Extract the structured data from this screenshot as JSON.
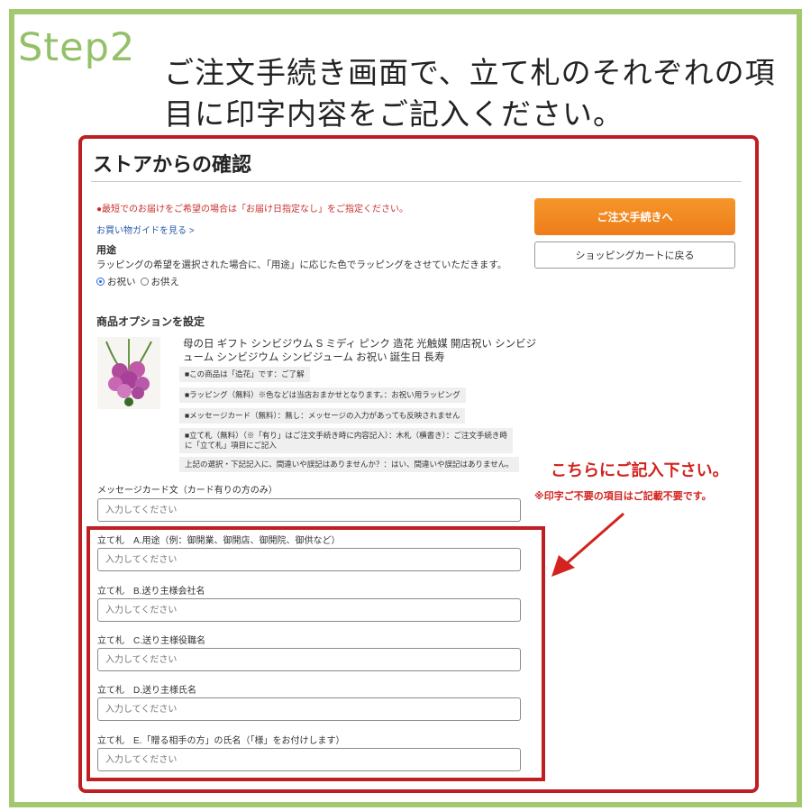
{
  "header": {
    "step": "Step2",
    "instruction": "ご注文手続き画面で、立て札のそれぞれの項目に印字内容をご記入ください。"
  },
  "panel": {
    "title": "ストアからの確認",
    "notice": "●最短でのお届けをご希望の場合は「お届け日指定なし」をご指定ください。",
    "guide_link": "お買い物ガイドを見る >",
    "usage": {
      "label": "用途",
      "description": "ラッピングの希望を選択された場合に、「用途」に応じた色でラッピングをさせていただきます。",
      "options": [
        {
          "label": "お祝い",
          "checked": true
        },
        {
          "label": "お供え",
          "checked": false
        }
      ]
    },
    "buttons": {
      "checkout": "ご注文手続きへ",
      "back_to_cart": "ショッピングカートに戻る"
    },
    "options_title": "商品オプションを設定",
    "product": {
      "name": "母の日 ギフト シンビジウム S ミディ ピンク 造花 光触媒 開店祝い シンビジューム シンビジウム シンビジューム お祝い 誕生日 長寿",
      "rows": [
        "■この商品は「造花」です：ご了解",
        "■ラッピング（無料）※色などは当店おまかせとなります。：お祝い用ラッピング",
        "■メッセージカード（無料）：無し：メッセージの入力があっても反映されません",
        "■立て札（無料）（※「有り」はご注文手続き時に内容記入）：木札（横書き）：ご注文手続き時に「立て札」項目にご記入",
        "上記の選択・下記記入に、間違いや誤記はありませんか？：はい、間違いや誤記はありません。"
      ]
    },
    "fields": [
      {
        "label": "メッセージカード文（カード有りの方のみ）",
        "placeholder": "入力してください"
      },
      {
        "label": "立て札　A.用途（例：御開業、御開店、御開院、御供など）",
        "placeholder": "入力してください"
      },
      {
        "label": "立て札　B.送り主様会社名",
        "placeholder": "入力してください"
      },
      {
        "label": "立て札　C.送り主様役職名",
        "placeholder": "入力してください"
      },
      {
        "label": "立て札　D.送り主様氏名",
        "placeholder": "入力してください"
      },
      {
        "label": "立て札　E.「贈る相手の方」の氏名（「様」をお付けします）",
        "placeholder": "入力してください"
      }
    ]
  },
  "callout": {
    "main": "こちらにご記入下さい。",
    "note": "※印字ご不要の項目はご記載不要です。"
  },
  "colors": {
    "frame_green": "#a3c86e",
    "highlight_red": "#bf1e23",
    "button_orange": "#ee7d1a"
  }
}
